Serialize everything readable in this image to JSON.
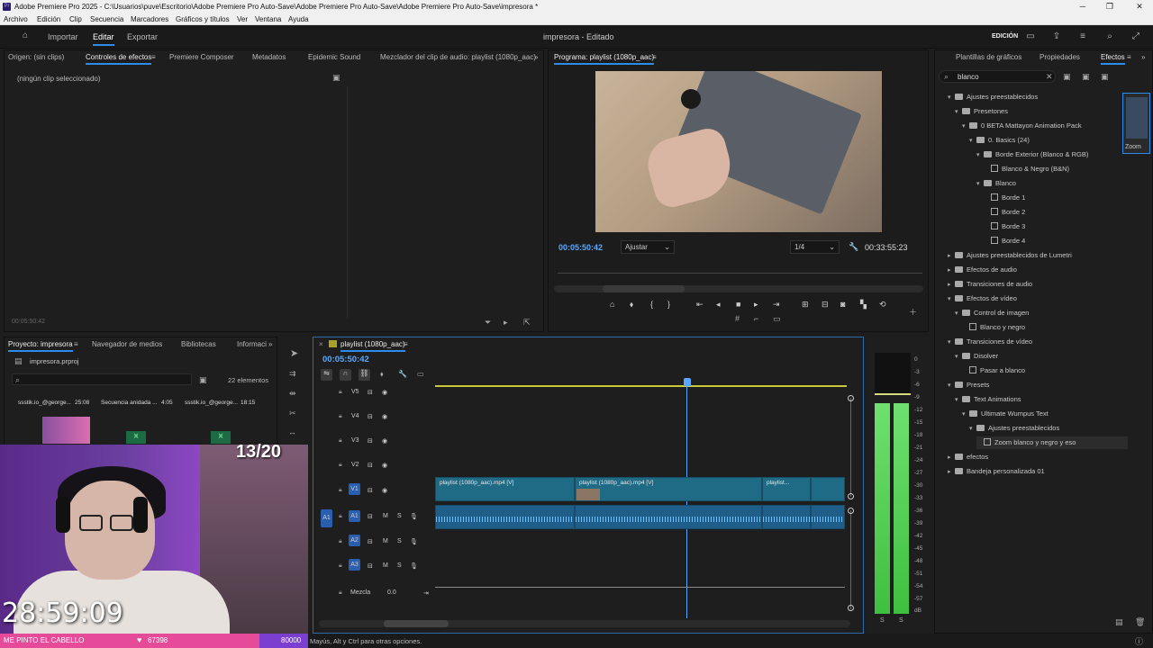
{
  "window": {
    "title": "Adobe Premiere Pro 2025 - C:\\Usuarios\\puve\\Escritorio\\Adobe Premiere Pro Auto-Save\\Adobe Premiere Pro Auto-Save\\Adobe Premiere Pro Auto-Save\\impresora *",
    "minimize": "─",
    "maximize": "❐",
    "close": "✕"
  },
  "menu": [
    "Archivo",
    "Edición",
    "Clip",
    "Secuencia",
    "Marcadores",
    "Gráficos y títulos",
    "Ver",
    "Ventana",
    "Ayuda"
  ],
  "appbar": {
    "tabs": [
      "Importar",
      "Editar",
      "Exportar"
    ],
    "active_tab": "Editar",
    "document": "impresora - Editado",
    "workspace": "EDICIÓN"
  },
  "source_panel": {
    "tabs": [
      "Origen: (sin clips)",
      "Controles de efectos",
      "Premiere Composer",
      "Metadatos",
      "Epidemic Sound",
      "Mezclador del clip de audio: playlist (1080p_aac)"
    ],
    "active_tab": "Controles de efectos",
    "no_clip": "(ningún clip seleccionado)",
    "timecode": "00:05:50:42"
  },
  "program": {
    "tab": "Programa: playlist (1080p_aac)",
    "timecode": "00:05:50:42",
    "fit": "Ajustar",
    "resolution": "1/4",
    "duration": "00:33:55:23"
  },
  "project": {
    "tabs": [
      "Proyecto: impresora",
      "Navegador de medios",
      "Bibliotecas",
      "Informaci"
    ],
    "file": "impresora.prproj",
    "count": "22 elementos",
    "items": [
      {
        "name": "ssstik.io_@george...",
        "dur": "25:08"
      },
      {
        "name": "Secuencia anidada ...",
        "dur": "4:05"
      },
      {
        "name": "ssstik.io_@george...",
        "dur": "18:15"
      }
    ]
  },
  "timeline": {
    "tab": "playlist (1080p_aac)",
    "timecode": "00:05:50:42",
    "video_tracks": [
      "V5",
      "V4",
      "V3",
      "V2",
      "V1"
    ],
    "audio_tracks": [
      "A1",
      "A2",
      "A3"
    ],
    "source_patch": "A1",
    "mix_label": "Mezcla",
    "mix_value": "0.0",
    "mute": "M",
    "solo": "S",
    "clips": [
      "playlist (1080p_aac).mp4 [V]",
      "playlist (1080p_aac).mp4 [V]",
      "playlist..."
    ]
  },
  "meter": {
    "scale": [
      "0",
      "-3",
      "-6",
      "-9",
      "-12",
      "-15",
      "-18",
      "-21",
      "-24",
      "-27",
      "-30",
      "-33",
      "-36",
      "-39",
      "-42",
      "-45",
      "-48",
      "-51",
      "-54",
      "-57",
      "dB"
    ],
    "solo_labels": [
      "S",
      "S"
    ]
  },
  "effects": {
    "tabs": [
      "Plantillas de gráficos",
      "Propiedades",
      "Efectos"
    ],
    "active_tab": "Efectos",
    "search": "blanco",
    "preview_label": "Zoom",
    "tree": [
      {
        "label": "Ajustes preestablecidos",
        "depth": 0,
        "type": "folder",
        "open": true
      },
      {
        "label": "Presetones",
        "depth": 1,
        "type": "folder",
        "open": true
      },
      {
        "label": "0 BETA Mattayon Animation Pack",
        "depth": 2,
        "type": "folder",
        "open": true
      },
      {
        "label": "0. Basics (24)",
        "depth": 3,
        "type": "folder",
        "open": true
      },
      {
        "label": "Borde Exterior (Blanco & RGB)",
        "depth": 4,
        "type": "folder",
        "open": true
      },
      {
        "label": "Blanco & Negro (B&N)",
        "depth": 5,
        "type": "fx"
      },
      {
        "label": "Blanco",
        "depth": 4,
        "type": "folder",
        "open": true
      },
      {
        "label": "Borde 1",
        "depth": 5,
        "type": "fx"
      },
      {
        "label": "Borde 2",
        "depth": 5,
        "type": "fx"
      },
      {
        "label": "Borde 3",
        "depth": 5,
        "type": "fx"
      },
      {
        "label": "Borde 4",
        "depth": 5,
        "type": "fx"
      },
      {
        "label": "Ajustes preestablecidos de Lumetri",
        "depth": 0,
        "type": "folder",
        "open": false
      },
      {
        "label": "Efectos de audio",
        "depth": 0,
        "type": "folder",
        "open": false
      },
      {
        "label": "Transiciones de audio",
        "depth": 0,
        "type": "folder",
        "open": false
      },
      {
        "label": "Efectos de vídeo",
        "depth": 0,
        "type": "folder",
        "open": true
      },
      {
        "label": "Control de imagen",
        "depth": 1,
        "type": "folder",
        "open": true
      },
      {
        "label": "Blanco y negro",
        "depth": 2,
        "type": "fx"
      },
      {
        "label": "Transiciones de vídeo",
        "depth": 0,
        "type": "folder",
        "open": true
      },
      {
        "label": "Disolver",
        "depth": 1,
        "type": "folder",
        "open": true
      },
      {
        "label": "Pasar a blanco",
        "depth": 2,
        "type": "fx"
      },
      {
        "label": "Presets",
        "depth": 0,
        "type": "folder",
        "open": true
      },
      {
        "label": "Text Animations",
        "depth": 1,
        "type": "folder",
        "open": true
      },
      {
        "label": "Ultimate Wumpus Text",
        "depth": 2,
        "type": "folder",
        "open": true
      },
      {
        "label": "Ajustes preestablecidos",
        "depth": 3,
        "type": "folder",
        "open": true
      },
      {
        "label": "Zoom blanco y negro y eso",
        "depth": 4,
        "type": "fx",
        "selected": true
      },
      {
        "label": "efectos",
        "depth": 0,
        "type": "folder",
        "open": false
      },
      {
        "label": "Bandeja personalizada 01",
        "depth": 0,
        "type": "folder",
        "open": false
      }
    ]
  },
  "overlay": {
    "counter": "13/20",
    "clock": "28:59:09",
    "goal_text": "ME PINTO EL CABELLO",
    "goal_current": "67398",
    "goal_target": "80000"
  },
  "status": "Mayús, Alt y Ctrl para otras opciones.",
  "colors": {
    "accent": "#2d8ceb",
    "timecode": "#59a8ff",
    "clip": "#1f6a85",
    "audio": "#1e5e88",
    "meter": "#3fbf3f"
  }
}
